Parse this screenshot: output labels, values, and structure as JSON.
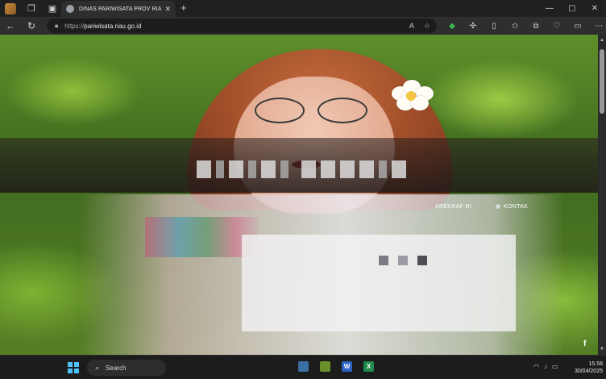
{
  "browser": {
    "tab": {
      "title": "DINAS PARIWISATA PROV RIAU",
      "close_glyph": "✕"
    },
    "new_tab_glyph": "+",
    "window_controls": {
      "minimize": "—",
      "maximize": "▢",
      "close": "✕"
    },
    "nav": {
      "back_glyph": "←",
      "refresh_glyph": "↻"
    },
    "address": {
      "scheme": "https://",
      "host": "pariwisata.riau.go.id"
    },
    "omnibox_icons": {
      "read_aloud": "A",
      "favorite": "☆"
    }
  },
  "page": {
    "nav_items": [
      {
        "label": "AREKRAF RI"
      },
      {
        "label": "KONTAK"
      }
    ],
    "social": {
      "facebook": "f"
    }
  },
  "taskbar": {
    "search_label": "Search",
    "apps": [
      {
        "letter": "W",
        "color": "#2b63c7"
      },
      {
        "letter": "X",
        "color": "#1f8a4c"
      }
    ],
    "clock": {
      "time": "15.58",
      "date": "30/04/2025"
    }
  },
  "colors": {
    "accent_windows": "#4cc2ff",
    "chrome_dark": "#202020"
  }
}
